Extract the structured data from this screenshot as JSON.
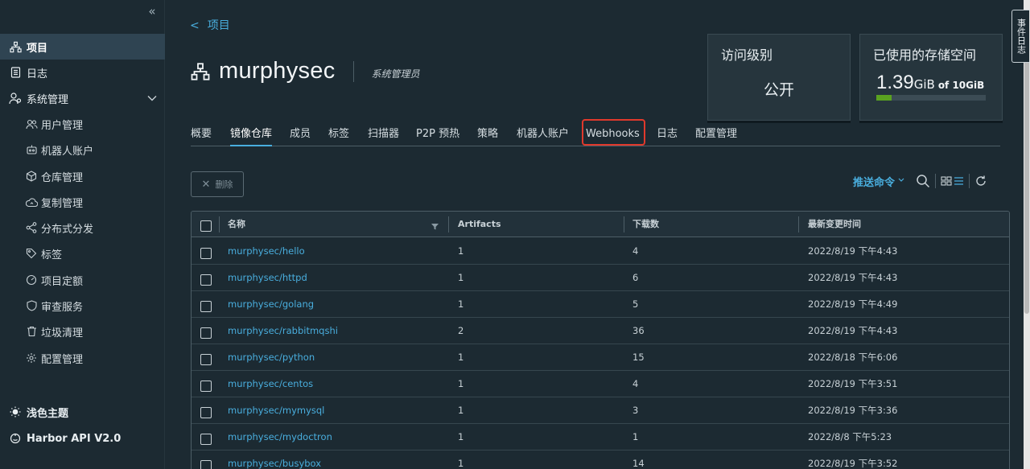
{
  "sidebar": {
    "collapse_icon": "double-chevron-left-icon",
    "items": [
      {
        "label": "项目",
        "icon": "project-icon"
      },
      {
        "label": "日志",
        "icon": "log-icon"
      },
      {
        "label": "系统管理",
        "icon": "admin-icon"
      },
      {
        "label": "用户管理",
        "icon": "users-icon"
      },
      {
        "label": "机器人账户",
        "icon": "robot-icon"
      },
      {
        "label": "仓库管理",
        "icon": "registry-icon"
      },
      {
        "label": "复制管理",
        "icon": "replication-icon"
      },
      {
        "label": "分布式分发",
        "icon": "distribution-icon"
      },
      {
        "label": "标签",
        "icon": "tag-icon"
      },
      {
        "label": "项目定额",
        "icon": "quota-icon"
      },
      {
        "label": "审查服务",
        "icon": "shield-icon"
      },
      {
        "label": "垃圾清理",
        "icon": "trash-icon"
      },
      {
        "label": "配置管理",
        "icon": "gear-icon"
      }
    ],
    "bottom": [
      {
        "label": "浅色主题",
        "icon": "sun-icon"
      },
      {
        "label": "Harbor API V2.0",
        "icon": "api-icon"
      }
    ]
  },
  "header": {
    "back_arrow": "<",
    "back_label": "项目",
    "project_name": "murphysec",
    "role": "系统管理员"
  },
  "cards": {
    "access_title": "访问级别",
    "access_value": "公开",
    "storage_title": "已使用的存储空间",
    "storage_amount": "1.39",
    "storage_unit": "GiB",
    "storage_of": "of 10GiB",
    "storage_fraction": 0.139,
    "storage_color": "#5aa220"
  },
  "tabs": [
    {
      "label": "概要",
      "active": false
    },
    {
      "label": "镜像仓库",
      "active": true
    },
    {
      "label": "成员",
      "active": false
    },
    {
      "label": "标签",
      "active": false
    },
    {
      "label": "扫描器",
      "active": false
    },
    {
      "label": "P2P 预热",
      "active": false
    },
    {
      "label": "策略",
      "active": false
    },
    {
      "label": "机器人账户",
      "active": false
    },
    {
      "label": "Webhooks",
      "active": false,
      "highlighted": true
    },
    {
      "label": "日志",
      "active": false
    },
    {
      "label": "配置管理",
      "active": false
    }
  ],
  "toolbar": {
    "delete_label": "删除",
    "push_command_label": "推送命令"
  },
  "table": {
    "columns": [
      "名称",
      "Artifacts",
      "下载数",
      "最新变更时间"
    ],
    "rows": [
      {
        "name": "murphysec/hello",
        "artifacts": "1",
        "pulls": "4",
        "updated": "2022/8/19 下午4:43"
      },
      {
        "name": "murphysec/httpd",
        "artifacts": "1",
        "pulls": "6",
        "updated": "2022/8/19 下午4:43"
      },
      {
        "name": "murphysec/golang",
        "artifacts": "1",
        "pulls": "5",
        "updated": "2022/8/19 下午4:49"
      },
      {
        "name": "murphysec/rabbitmqshi",
        "artifacts": "2",
        "pulls": "36",
        "updated": "2022/8/19 下午4:43"
      },
      {
        "name": "murphysec/python",
        "artifacts": "1",
        "pulls": "15",
        "updated": "2022/8/18 下午6:06"
      },
      {
        "name": "murphysec/centos",
        "artifacts": "1",
        "pulls": "4",
        "updated": "2022/8/19 下午3:51"
      },
      {
        "name": "murphysec/mymysql",
        "artifacts": "1",
        "pulls": "3",
        "updated": "2022/8/19 下午3:36"
      },
      {
        "name": "murphysec/mydoctron",
        "artifacts": "1",
        "pulls": "1",
        "updated": "2022/8/8 下午5:23"
      },
      {
        "name": "murphysec/busybox",
        "artifacts": "1",
        "pulls": "14",
        "updated": "2022/8/19 下午3:52"
      }
    ]
  },
  "event_log_label": "事件日志",
  "colors": {
    "accent": "#49aede",
    "background": "#1c2a32",
    "highlight_border": "#e0392c"
  }
}
